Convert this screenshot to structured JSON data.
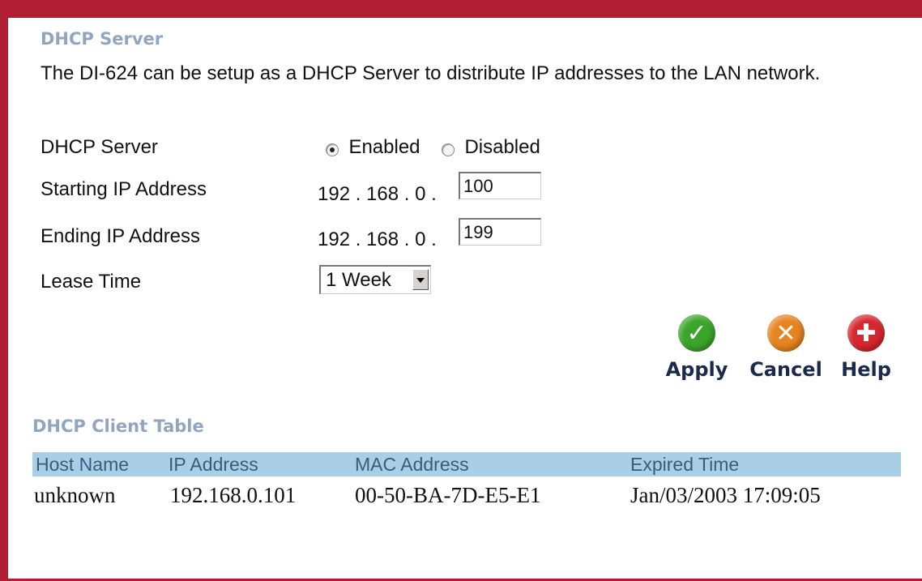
{
  "dhcp_server": {
    "title": "DHCP Server",
    "description": "The DI-624 can be setup as a DHCP Server to distribute IP addresses to the LAN network.",
    "server_label": "DHCP Server",
    "enabled_label": "Enabled",
    "disabled_label": "Disabled",
    "enabled_selected": true,
    "start_label": "Starting IP Address",
    "start_prefix": "192 . 168 . 0 .",
    "start_value": "100",
    "end_label": "Ending IP Address",
    "end_prefix": "192 . 168 . 0 .",
    "end_value": "199",
    "lease_label": "Lease Time",
    "lease_value": "1 Week"
  },
  "buttons": {
    "apply": "Apply",
    "cancel": "Cancel",
    "help": "Help",
    "apply_color": "#3aa52a",
    "cancel_color": "#e8841f",
    "help_color": "#d7262e"
  },
  "client_table": {
    "title": "DHCP Client Table",
    "columns": [
      "Host Name",
      "IP Address",
      "MAC Address",
      "Expired Time"
    ],
    "rows": [
      [
        "unknown",
        "192.168.0.101",
        "00-50-BA-7D-E5-E1",
        "Jan/03/2003 17:09:05"
      ]
    ]
  }
}
